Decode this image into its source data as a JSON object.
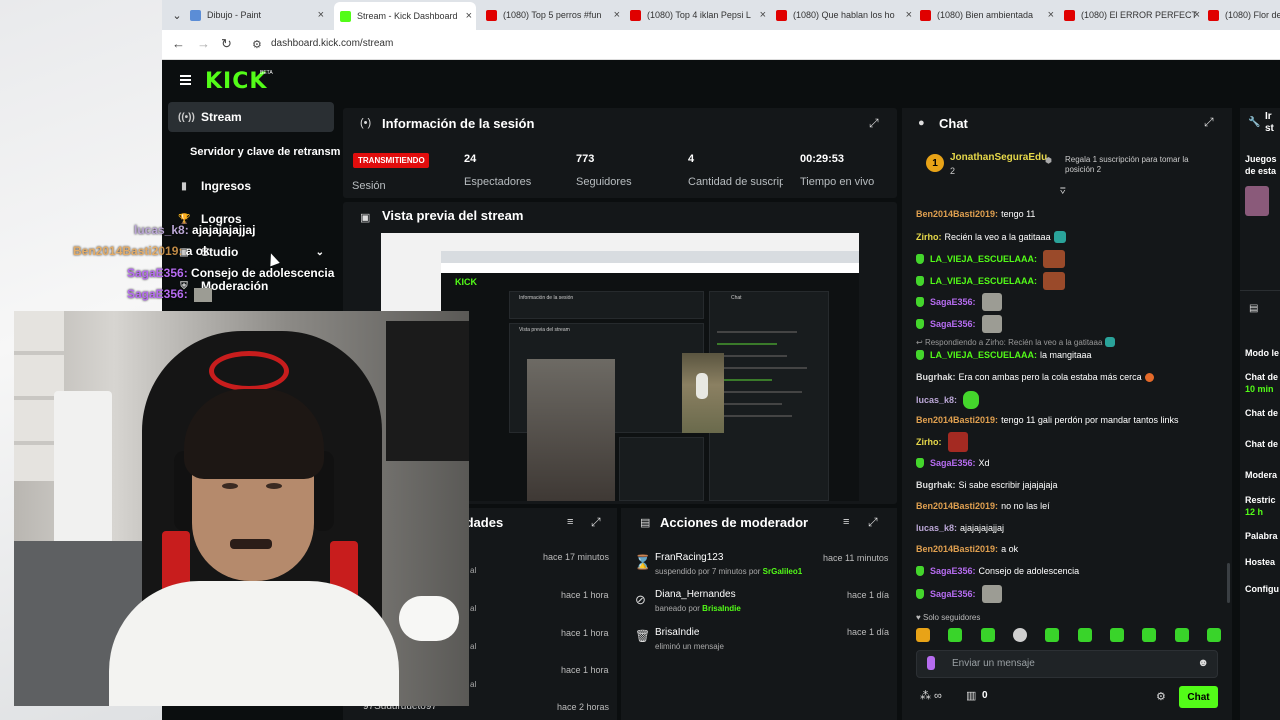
{
  "browser": {
    "tabs": [
      {
        "label": "Dibujo - Paint",
        "color": "#5b8dd6"
      },
      {
        "label": "Stream - Kick Dashboard",
        "color": "#53fc18"
      },
      {
        "label": "(1080) Top 5 perros #fun",
        "color": "#e00000"
      },
      {
        "label": "(1080) Top 4 iklan Pepsi L",
        "color": "#e00000"
      },
      {
        "label": "(1080) Que hablan los ho",
        "color": "#e00000"
      },
      {
        "label": "(1080) Bien ambientada",
        "color": "#e00000"
      },
      {
        "label": "(1080) El ERROR PERFECT",
        "color": "#e00000"
      },
      {
        "label": "(1080) Flor de",
        "color": "#e00000"
      }
    ],
    "url": "dashboard.kick.com/stream"
  },
  "app": {
    "logo": "KICK",
    "beta": "BETA",
    "accent": "#53fc18"
  },
  "sidebar": {
    "items": [
      {
        "label": "Stream",
        "icon": "broadcast-icon"
      },
      {
        "label": "Servidor y clave de retransm",
        "icon": ""
      },
      {
        "label": "Ingresos",
        "icon": "chart-icon"
      },
      {
        "label": "Logros",
        "icon": "trophy-icon"
      },
      {
        "label": "Studio",
        "icon": "studio-icon"
      },
      {
        "label": "Moderación",
        "icon": "shield-icon"
      }
    ]
  },
  "session": {
    "title": "Información de la sesión",
    "status": "TRANSMITIENDO",
    "stats": [
      {
        "label": "Sesión",
        "value": ""
      },
      {
        "label": "Espectadores",
        "value": "24"
      },
      {
        "label": "Seguidores",
        "value": "773"
      },
      {
        "label": "Cantidad de suscripciones",
        "value": "4"
      },
      {
        "label": "Tiempo en vivo",
        "value": "00:29:53"
      }
    ]
  },
  "preview": {
    "title": "Vista previa del stream"
  },
  "overlay_chat": [
    {
      "name": "lucas_k8:",
      "text": "ajajajajajjaj",
      "color": "#bba7d6"
    },
    {
      "name": "Ben2014Basti2019:",
      "text": "a ok",
      "color": "#e0a050"
    },
    {
      "name": "SagaE356:",
      "text": "Consejo de adolescencia",
      "color": "#b66cf0"
    },
    {
      "name": "SagaE356:",
      "text": "",
      "color": "#b66cf0"
    }
  ],
  "activity": {
    "title": "idades",
    "rows": [
      {
        "name": "",
        "sub": "al",
        "time": "hace 17 minutos"
      },
      {
        "name": "",
        "sub": "al",
        "time": "hace 1 hora"
      },
      {
        "name": "",
        "sub": "al",
        "time": "hace 1 hora"
      },
      {
        "name": "",
        "sub": "al",
        "time": "hace 1 hora"
      },
      {
        "name": "97Suduruueto97",
        "sub": "",
        "time": "hace 2 horas"
      }
    ]
  },
  "modactions": {
    "title": "Acciones de moderador",
    "rows": [
      {
        "user": "FranRacing123",
        "action": "suspendido por 7 minutos por",
        "by": "SrGalileo1",
        "time": "hace 11 minutos",
        "icon": "hourglass-icon"
      },
      {
        "user": "Diana_Hernandes",
        "action": "baneado por",
        "by": "BrisaIndie",
        "time": "hace 1 día",
        "icon": "ban-icon"
      },
      {
        "user": "BrisaIndie",
        "action": "eliminó un mensaje",
        "by": "",
        "time": "hace 1 día",
        "icon": "trash-icon"
      }
    ]
  },
  "chat": {
    "title": "Chat",
    "pinned_user": "JonathanSeguraEdu",
    "pinned_count": "2",
    "gift_text_1": "Regala 1 suscripción para tomar la",
    "gift_text_2": "posición 2",
    "messages": [
      {
        "name": "Ben2014Basti2019:",
        "text": "tengo 11",
        "color": "#e0a050",
        "badge": false
      },
      {
        "name": "Zirho:",
        "text": "Recién la veo a la gatitaaa",
        "color": "#e6d84a",
        "badge": false
      },
      {
        "name": "LA_VIEJA_ESCUELAAA:",
        "text": "",
        "color": "#53fc18",
        "badge": true
      },
      {
        "name": "LA_VIEJA_ESCUELAAA:",
        "text": "",
        "color": "#53fc18",
        "badge": true
      },
      {
        "name": "SagaE356:",
        "text": "",
        "color": "#b66cf0",
        "badge": true
      },
      {
        "name": "SagaE356:",
        "text": "",
        "color": "#b66cf0",
        "badge": true
      },
      {
        "name": "LA_VIEJA_ESCUELAAA:",
        "text": "la mangitaaa",
        "color": "#53fc18",
        "badge": true,
        "reply": "Respondiendo a Zirho: Recién la veo a la gatitaaa"
      },
      {
        "name": "Bugrhak:",
        "text": "Era con ambas pero la cola estaba más cerca",
        "color": "#dddddd",
        "badge": false
      },
      {
        "name": "lucas_k8:",
        "text": "",
        "color": "#bba7d6",
        "badge": false
      },
      {
        "name": "Ben2014Basti2019:",
        "text": "tengo 11 gali perdón por mandar tantos links",
        "color": "#e0a050",
        "badge": false
      },
      {
        "name": "Zirho:",
        "text": "",
        "color": "#e6d84a",
        "badge": false
      },
      {
        "name": "SagaE356:",
        "text": "Xd",
        "color": "#b66cf0",
        "badge": true
      },
      {
        "name": "Bugrhak:",
        "text": "Si sabe escribir jajajajaja",
        "color": "#dddddd",
        "badge": false
      },
      {
        "name": "Ben2014Basti2019:",
        "text": "no no las leí",
        "color": "#e0a050",
        "badge": false
      },
      {
        "name": "lucas_k8:",
        "text": "ajajajajajjaj",
        "color": "#bba7d6",
        "badge": false
      },
      {
        "name": "Ben2014Basti2019:",
        "text": "a ok",
        "color": "#e0a050",
        "badge": false
      },
      {
        "name": "SagaE356:",
        "text": "Consejo de adolescencia",
        "color": "#b66cf0",
        "badge": true
      },
      {
        "name": "SagaE356:",
        "text": "",
        "color": "#b66cf0",
        "badge": true
      }
    ],
    "followers_only": "Solo seguidores",
    "input_placeholder": "Enviar un mensaje",
    "count": "0",
    "send_label": "Chat"
  },
  "right_panel": {
    "title": "Ir st",
    "items": [
      "Juegos",
      "de esta",
      "Modo le",
      "Chat de",
      "10 min",
      "Chat de",
      "Chat de",
      "Modera",
      "Restric",
      "12 h",
      "Palabra",
      "Hostea",
      "Configu"
    ]
  }
}
